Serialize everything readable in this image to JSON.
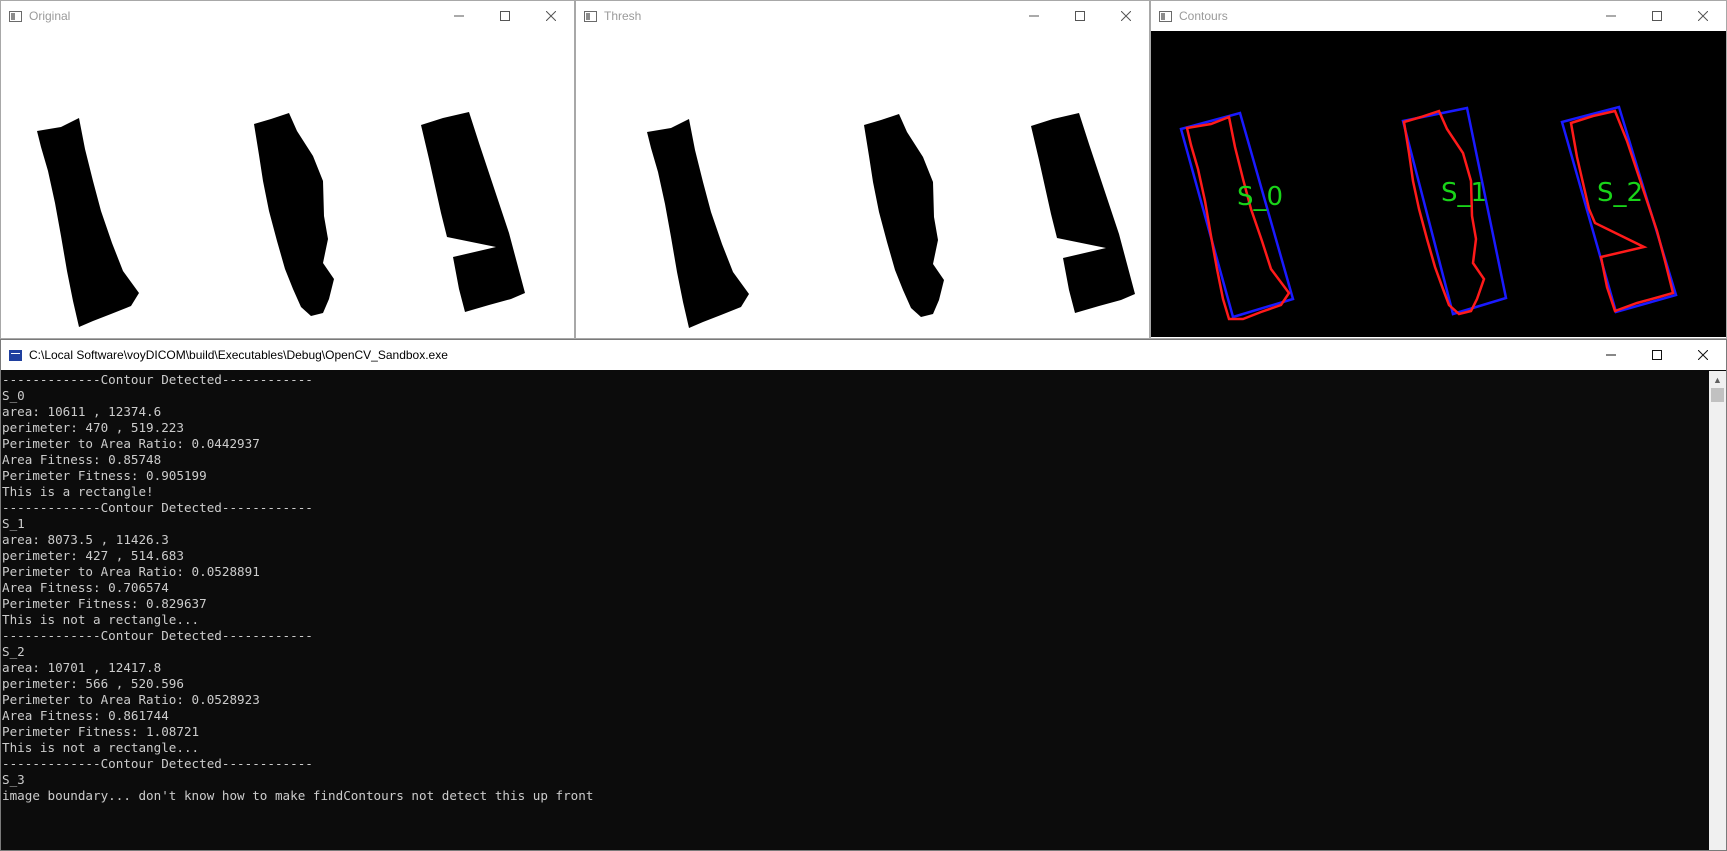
{
  "windows": {
    "original": {
      "title": "Original"
    },
    "thresh": {
      "title": "Thresh"
    },
    "contours": {
      "title": "Contours",
      "labels": [
        "S_0",
        "S_1",
        "S_2"
      ],
      "colors": {
        "background": "#000000",
        "contour": "#ff1a1a",
        "box": "#1a1aff",
        "label": "#19d419"
      }
    },
    "console": {
      "title": "C:\\Local Software\\voyDICOM\\build\\Executables\\Debug\\OpenCV_Sandbox.exe",
      "lines": [
        "-------------Contour Detected------------",
        "S_0",
        "area: 10611 , 12374.6",
        "perimeter: 470 , 519.223",
        "Perimeter to Area Ratio: 0.0442937",
        "Area Fitness: 0.85748",
        "Perimeter Fitness: 0.905199",
        "This is a rectangle!",
        "-------------Contour Detected------------",
        "S_1",
        "area: 8073.5 , 11426.3",
        "perimeter: 427 , 514.683",
        "Perimeter to Area Ratio: 0.0528891",
        "Area Fitness: 0.706574",
        "Perimeter Fitness: 0.829637",
        "This is not a rectangle...",
        "-------------Contour Detected------------",
        "S_2",
        "area: 10701 , 12417.8",
        "perimeter: 566 , 520.596",
        "Perimeter to Area Ratio: 0.0528923",
        "Area Fitness: 0.861744",
        "Perimeter Fitness: 1.08721",
        "This is not a rectangle...",
        "-------------Contour Detected------------",
        "S_3",
        "image boundary... don't know how to make findContours not detect this up front"
      ]
    }
  },
  "icons": {
    "minimize": "minimize-icon",
    "maximize": "maximize-icon",
    "close": "close-icon",
    "app": "window-app-icon",
    "console": "console-app-icon",
    "scroll_up": "scroll-up-arrow-icon"
  }
}
